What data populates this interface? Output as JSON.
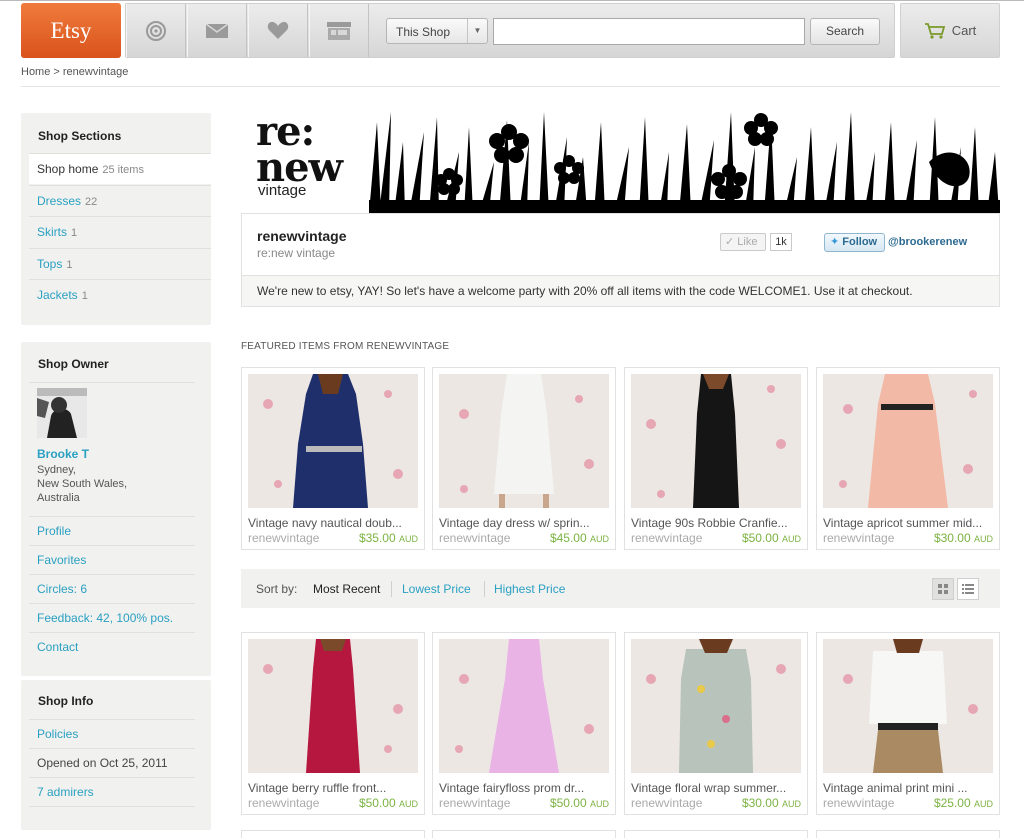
{
  "header": {
    "logo": "Etsy",
    "scope_label": "This Shop",
    "search_value": "",
    "search_button": "Search",
    "cart_label": "Cart"
  },
  "breadcrumb": "Home > renewvintage",
  "sidebar": {
    "sections_title": "Shop Sections",
    "sections": [
      {
        "label": "Shop home",
        "count": "25 items"
      },
      {
        "label": "Dresses",
        "count": "22"
      },
      {
        "label": "Skirts",
        "count": "1"
      },
      {
        "label": "Tops",
        "count": "1"
      },
      {
        "label": "Jackets",
        "count": "1"
      }
    ],
    "owner_title": "Shop Owner",
    "owner_name": "Brooke T",
    "owner_location_1": "Sydney,",
    "owner_location_2": "New South Wales,",
    "owner_location_3": "Australia",
    "owner_links": [
      "Profile",
      "Favorites",
      "Circles: 6",
      "Feedback: 42, 100% pos.",
      "Contact"
    ],
    "info_title": "Shop Info",
    "info_policies": "Policies",
    "info_opened": "Opened on Oct 25, 2011",
    "info_admirers": "7 admirers"
  },
  "banner": {
    "line1": "re:",
    "line2": "new",
    "line3": "vintage"
  },
  "shop": {
    "name": "renewvintage",
    "subtitle": "re:new vintage",
    "like_label": "Like",
    "like_count": "1k",
    "follow_label": "Follow",
    "twitter_handle": "@brookerenew",
    "announcement": "We're new to etsy, YAY! So let's have a welcome party with 20% off all items with the code WELCOME1. Use it at checkout."
  },
  "featured_label": "FEATURED ITEMS FROM RENEWVINTAGE",
  "featured": [
    {
      "title": "Vintage navy nautical doub...",
      "shop": "renewvintage",
      "price": "$35.00",
      "currency": "AUD"
    },
    {
      "title": "Vintage day dress w/ sprin...",
      "shop": "renewvintage",
      "price": "$45.00",
      "currency": "AUD"
    },
    {
      "title": "Vintage 90s Robbie Cranfie...",
      "shop": "renewvintage",
      "price": "$50.00",
      "currency": "AUD"
    },
    {
      "title": "Vintage apricot summer mid...",
      "shop": "renewvintage",
      "price": "$30.00",
      "currency": "AUD"
    }
  ],
  "sort": {
    "label": "Sort by:",
    "options": [
      "Most Recent",
      "Lowest Price",
      "Highest Price"
    ]
  },
  "listings": [
    {
      "title": "Vintage berry ruffle front...",
      "shop": "renewvintage",
      "price": "$50.00",
      "currency": "AUD"
    },
    {
      "title": "Vintage fairyfloss prom dr...",
      "shop": "renewvintage",
      "price": "$50.00",
      "currency": "AUD"
    },
    {
      "title": "Vintage floral wrap summer...",
      "shop": "renewvintage",
      "price": "$30.00",
      "currency": "AUD"
    },
    {
      "title": "Vintage animal print mini ...",
      "shop": "renewvintage",
      "price": "$25.00",
      "currency": "AUD"
    }
  ],
  "colors": {
    "brand": "#e8652a",
    "link": "#2aa0c2",
    "price": "#7cb342"
  }
}
